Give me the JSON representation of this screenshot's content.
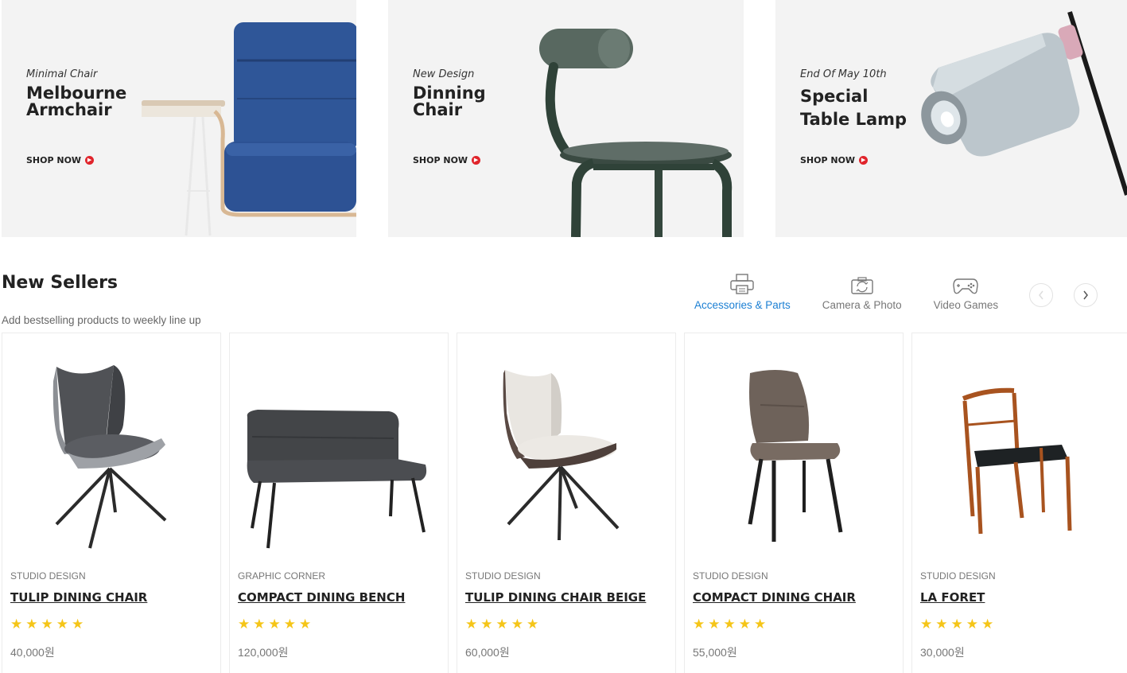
{
  "banners": [
    {
      "subtitle": "Minimal Chair",
      "title": "Melbourne Armchair",
      "cta": "SHOP NOW"
    },
    {
      "subtitle": "New Design",
      "title": "Dinning Chair",
      "cta": "SHOP NOW"
    },
    {
      "subtitle": "End Of May 10th",
      "title": "Special Table Lamp",
      "cta": "SHOP NOW"
    }
  ],
  "section": {
    "title": "New Sellers",
    "subtitle": "Add bestselling products to weekly line up"
  },
  "category_tabs": [
    {
      "label": "Accessories & Parts",
      "icon": "printer-icon",
      "active": true
    },
    {
      "label": "Camera & Photo",
      "icon": "camera-icon",
      "active": false
    },
    {
      "label": "Video Games",
      "icon": "gamepad-icon",
      "active": false
    }
  ],
  "products": [
    {
      "brand": "STUDIO DESIGN",
      "name": "TULIP DINING CHAIR",
      "rating": 5,
      "price": "40,000원"
    },
    {
      "brand": "GRAPHIC CORNER",
      "name": "COMPACT DINING BENCH",
      "rating": 5,
      "price": "120,000원"
    },
    {
      "brand": "STUDIO DESIGN",
      "name": "TULIP DINING CHAIR BEIGE",
      "rating": 5,
      "price": "60,000원"
    },
    {
      "brand": "STUDIO DESIGN",
      "name": "COMPACT DINING CHAIR",
      "rating": 5,
      "price": "55,000원"
    },
    {
      "brand": "STUDIO DESIGN",
      "name": "LA FORET",
      "rating": 5,
      "price": "30,000원"
    }
  ],
  "colors": {
    "accent_active": "#1b7fd3",
    "cta_dot": "#e0242b",
    "star": "#f5c518",
    "banner_bg": "#f3f3f3"
  }
}
